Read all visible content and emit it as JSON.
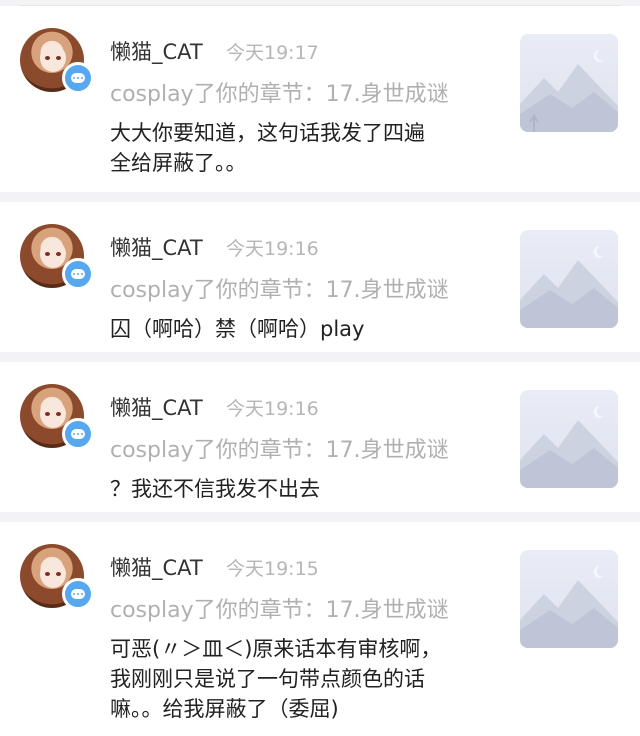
{
  "notifications": [
    {
      "user": "懒猫_CAT",
      "time": "今天19:17",
      "source": "cosplay了你的章节：17.身世成谜",
      "content": "大大你要知道，这句话我发了四遍\n全给屏蔽了。。"
    },
    {
      "user": "懒猫_CAT",
      "time": "今天19:16",
      "source": "cosplay了你的章节：17.身世成谜",
      "content": "囚（啊哈）禁（啊哈）play"
    },
    {
      "user": "懒猫_CAT",
      "time": "今天19:16",
      "source": "cosplay了你的章节：17.身世成谜",
      "content": "？我还不信我发不出去"
    },
    {
      "user": "懒猫_CAT",
      "time": "今天19:15",
      "source": "cosplay了你的章节：17.身世成谜",
      "content": "可恶(〃＞皿＜)原来话本有审核啊，\n我刚刚只是说了一句带点颜色的话\n嘛。。给我屏蔽了（委屈)"
    }
  ],
  "icons": {
    "comment_badge": "comment-bubble-icon",
    "thumbnail": "mountain-placeholder-icon"
  },
  "colors": {
    "badge": "#58a8f1",
    "background": "#f3f3f5"
  }
}
